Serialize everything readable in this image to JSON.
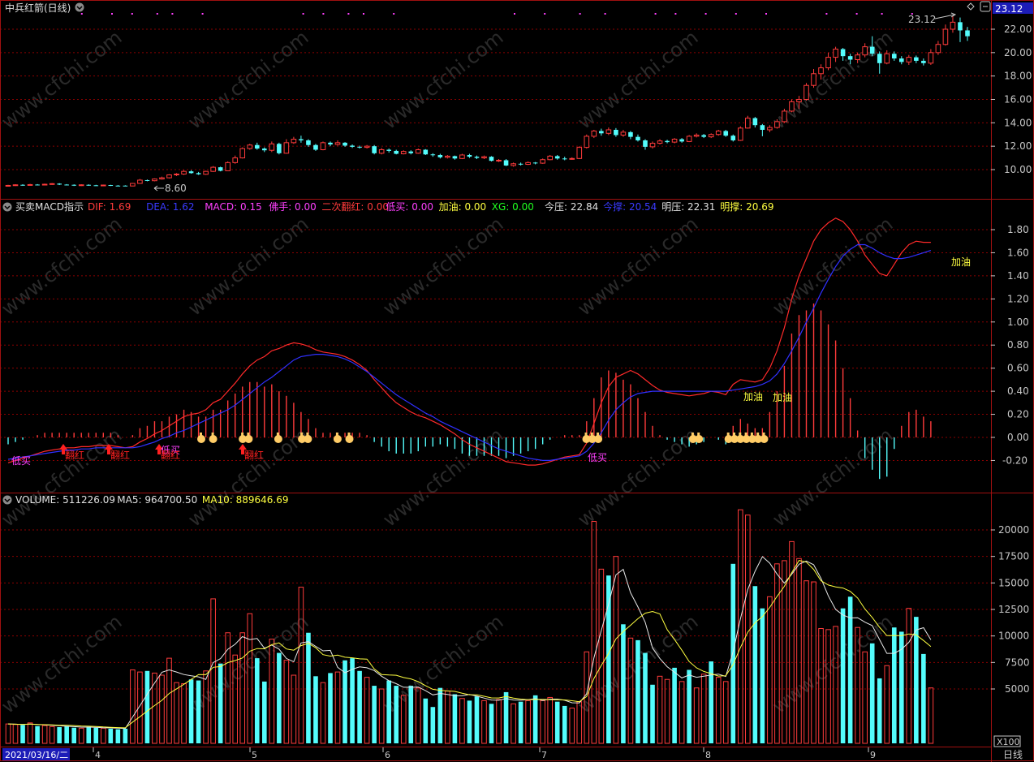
{
  "panels": {
    "price": {
      "title": "中兵红箭(日线)",
      "right_price_tag": "23.12",
      "annot_high": "23.12",
      "annot_low": "8.60",
      "axis_labels": [
        "22.00",
        "20.00",
        "18.00",
        "16.00",
        "14.00",
        "12.00",
        "10.00"
      ]
    },
    "macd": {
      "name": "买卖MACD指示",
      "items": [
        {
          "label": "DIF: 1.69",
          "color": "#ff3b3b"
        },
        {
          "label": "DEA: 1.62",
          "color": "#3a3aff"
        },
        {
          "label": "MACD: 0.15",
          "color": "#ff40ff"
        },
        {
          "label": "佛手: 0.00",
          "color": "#ff40ff"
        },
        {
          "label": "二次翻红: 0.00",
          "color": "#ff3b3b"
        },
        {
          "label": "低买: 0.00",
          "color": "#ff40ff"
        },
        {
          "label": "加油: 0.00",
          "color": "#ffff40"
        },
        {
          "label": "XG: 0.00",
          "color": "#20ff20"
        },
        {
          "label": "今压: 22.84",
          "color": "#e0e0e0"
        },
        {
          "label": "今撑: 20.54",
          "color": "#3a3aff"
        },
        {
          "label": "明压: 22.31",
          "color": "#e0e0e0"
        },
        {
          "label": "明撑: 20.69",
          "color": "#ffff40"
        }
      ],
      "axis_labels": [
        "1.80",
        "1.60",
        "1.40",
        "1.20",
        "1.00",
        "0.80",
        "0.60",
        "0.40",
        "0.20",
        "0.00",
        "-0.20"
      ],
      "signals": {
        "low_buy": "低买",
        "turn_red": "翻红",
        "refuel": "加油",
        "low_buy_turn": "低买 翻红"
      }
    },
    "volume": {
      "items": [
        {
          "label": "VOLUME: 511226.09",
          "color": "#e0e0e0"
        },
        {
          "label": "MA5: 964700.50",
          "color": "#e0e0e0"
        },
        {
          "label": "MA10: 889646.69",
          "color": "#ffff40"
        }
      ],
      "axis_labels": [
        "20000",
        "17500",
        "15000",
        "12500",
        "10000",
        "7500",
        "5000"
      ],
      "unit": "X100"
    }
  },
  "xaxis": {
    "start_date": "2021/03/16/二",
    "months": [
      "4",
      "5",
      "6",
      "7",
      "8",
      "9"
    ],
    "period": "日线"
  },
  "watermark": "www.cfchi.com",
  "colors": {
    "up": "#ff3b3b",
    "down": "#54fcfc",
    "grid": "#8b0000",
    "frame": "#a01010",
    "bg": "#000000"
  },
  "chart_data": {
    "type": "candlestick",
    "title": "中兵红箭(日线)",
    "price_range": [
      8.6,
      23.12
    ],
    "volume_unit": "X100",
    "volume_ylim": [
      0,
      22000
    ],
    "macd_ylim": [
      -0.35,
      1.95
    ],
    "candles": [
      [
        8.62,
        8.65,
        8.55,
        8.7,
        1
      ],
      [
        8.65,
        8.7,
        8.6,
        8.75,
        1
      ],
      [
        8.7,
        8.68,
        8.62,
        8.75,
        0
      ],
      [
        8.68,
        8.72,
        8.64,
        8.78,
        1
      ],
      [
        8.72,
        8.7,
        8.66,
        8.76,
        0
      ],
      [
        8.7,
        8.75,
        8.66,
        8.8,
        1
      ],
      [
        8.75,
        8.8,
        8.7,
        8.85,
        1
      ],
      [
        8.8,
        8.72,
        8.68,
        8.84,
        0
      ],
      [
        8.72,
        8.7,
        8.66,
        8.76,
        0
      ],
      [
        8.7,
        8.65,
        8.6,
        8.74,
        0
      ],
      [
        8.65,
        8.7,
        8.6,
        8.74,
        1
      ],
      [
        8.7,
        8.66,
        8.62,
        8.74,
        0
      ],
      [
        8.66,
        8.64,
        8.6,
        8.7,
        0
      ],
      [
        8.64,
        8.68,
        8.6,
        8.72,
        1
      ],
      [
        8.68,
        8.62,
        8.6,
        8.7,
        0
      ],
      [
        8.62,
        8.63,
        8.58,
        8.68,
        0
      ],
      [
        8.63,
        8.6,
        8.6,
        8.66,
        0
      ],
      [
        8.6,
        8.82,
        8.6,
        8.86,
        1
      ],
      [
        8.82,
        9.1,
        8.8,
        9.2,
        1
      ],
      [
        9.1,
        9.05,
        9.0,
        9.15,
        0
      ],
      [
        9.05,
        9.2,
        9.0,
        9.25,
        1
      ],
      [
        9.2,
        9.3,
        9.15,
        9.4,
        1
      ],
      [
        9.3,
        9.55,
        9.25,
        9.6,
        1
      ],
      [
        9.55,
        9.62,
        9.45,
        9.7,
        1
      ],
      [
        9.62,
        9.85,
        9.55,
        9.95,
        1
      ],
      [
        9.85,
        9.7,
        9.65,
        9.95,
        0
      ],
      [
        9.7,
        9.6,
        9.55,
        9.8,
        0
      ],
      [
        9.6,
        9.85,
        9.55,
        9.9,
        1
      ],
      [
        9.85,
        10.2,
        9.8,
        10.3,
        1
      ],
      [
        10.2,
        9.9,
        9.85,
        10.25,
        0
      ],
      [
        9.9,
        10.6,
        9.88,
        10.7,
        1
      ],
      [
        10.6,
        11.0,
        10.5,
        11.2,
        1
      ],
      [
        11.0,
        11.8,
        10.95,
        11.9,
        1
      ],
      [
        11.8,
        12.1,
        11.7,
        12.2,
        1
      ],
      [
        12.1,
        11.8,
        11.7,
        12.3,
        0
      ],
      [
        11.8,
        11.65,
        11.5,
        11.9,
        0
      ],
      [
        11.65,
        12.2,
        11.5,
        12.4,
        1
      ],
      [
        12.2,
        11.4,
        11.3,
        12.3,
        0
      ],
      [
        11.4,
        12.3,
        11.35,
        12.6,
        1
      ],
      [
        12.3,
        12.6,
        12.2,
        12.8,
        1
      ],
      [
        12.6,
        12.5,
        12.3,
        12.9,
        0
      ],
      [
        12.5,
        12.1,
        11.95,
        12.6,
        0
      ],
      [
        12.1,
        11.7,
        11.6,
        12.2,
        0
      ],
      [
        11.7,
        12.3,
        11.65,
        12.4,
        1
      ],
      [
        12.3,
        12.15,
        12.0,
        12.4,
        0
      ],
      [
        12.15,
        12.3,
        12.05,
        12.5,
        1
      ],
      [
        12.3,
        12.05,
        11.95,
        12.35,
        0
      ],
      [
        12.05,
        11.95,
        11.85,
        12.15,
        0
      ],
      [
        11.95,
        11.9,
        11.8,
        12.05,
        0
      ],
      [
        11.9,
        12.0,
        11.8,
        12.1,
        1
      ],
      [
        12.0,
        11.4,
        11.3,
        12.1,
        0
      ],
      [
        11.4,
        11.7,
        11.3,
        11.85,
        1
      ],
      [
        11.7,
        11.6,
        11.45,
        11.8,
        0
      ],
      [
        11.6,
        11.35,
        11.3,
        11.7,
        0
      ],
      [
        11.35,
        11.55,
        11.3,
        11.65,
        1
      ],
      [
        11.55,
        11.4,
        11.3,
        11.65,
        0
      ],
      [
        11.4,
        11.7,
        11.35,
        11.8,
        1
      ],
      [
        11.7,
        11.3,
        11.25,
        11.75,
        0
      ],
      [
        11.3,
        11.25,
        11.1,
        11.4,
        0
      ],
      [
        11.25,
        11.05,
        10.95,
        11.35,
        0
      ],
      [
        11.05,
        11.15,
        10.95,
        11.25,
        1
      ],
      [
        11.15,
        10.95,
        10.85,
        11.2,
        0
      ],
      [
        10.95,
        11.25,
        10.9,
        11.35,
        1
      ],
      [
        11.25,
        11.1,
        11.0,
        11.35,
        0
      ],
      [
        11.1,
        11.0,
        10.9,
        11.2,
        0
      ],
      [
        11.0,
        11.1,
        10.9,
        11.2,
        1
      ],
      [
        11.1,
        10.75,
        10.7,
        11.15,
        0
      ],
      [
        10.75,
        10.8,
        10.65,
        10.9,
        1
      ],
      [
        10.8,
        10.35,
        10.3,
        10.9,
        0
      ],
      [
        10.35,
        10.5,
        10.25,
        10.6,
        1
      ],
      [
        10.5,
        10.45,
        10.35,
        10.6,
        0
      ],
      [
        10.45,
        10.6,
        10.4,
        10.7,
        1
      ],
      [
        10.6,
        10.55,
        10.45,
        10.65,
        0
      ],
      [
        10.55,
        10.85,
        10.5,
        10.95,
        1
      ],
      [
        10.85,
        11.15,
        10.8,
        11.25,
        1
      ],
      [
        11.15,
        10.95,
        10.85,
        11.25,
        0
      ],
      [
        10.95,
        10.9,
        10.8,
        11.1,
        0
      ],
      [
        10.9,
        10.95,
        10.85,
        11.05,
        1
      ],
      [
        10.95,
        11.9,
        10.9,
        12.0,
        1
      ],
      [
        11.9,
        12.85,
        11.8,
        13.0,
        1
      ],
      [
        12.85,
        13.3,
        12.7,
        13.4,
        1
      ],
      [
        13.3,
        13.1,
        12.9,
        13.5,
        0
      ],
      [
        13.1,
        13.4,
        12.95,
        13.6,
        1
      ],
      [
        13.4,
        12.95,
        12.8,
        13.55,
        0
      ],
      [
        12.95,
        13.2,
        12.8,
        13.4,
        1
      ],
      [
        13.2,
        12.8,
        12.6,
        13.3,
        0
      ],
      [
        12.8,
        12.5,
        12.4,
        13.0,
        0
      ],
      [
        12.5,
        11.95,
        11.7,
        12.6,
        0
      ],
      [
        11.95,
        12.25,
        11.8,
        12.4,
        1
      ],
      [
        12.25,
        12.45,
        12.15,
        12.6,
        1
      ],
      [
        12.45,
        12.35,
        12.25,
        12.55,
        0
      ],
      [
        12.35,
        12.6,
        12.25,
        12.7,
        1
      ],
      [
        12.6,
        12.4,
        12.3,
        12.7,
        0
      ],
      [
        12.4,
        12.85,
        12.35,
        12.95,
        1
      ],
      [
        12.85,
        12.95,
        12.75,
        13.1,
        1
      ],
      [
        12.95,
        12.8,
        12.7,
        13.05,
        0
      ],
      [
        12.8,
        13.0,
        12.7,
        13.1,
        1
      ],
      [
        13.0,
        13.3,
        12.9,
        13.4,
        1
      ],
      [
        13.3,
        12.9,
        12.8,
        13.4,
        0
      ],
      [
        12.9,
        12.5,
        12.4,
        13.0,
        0
      ],
      [
        12.5,
        13.55,
        12.45,
        13.7,
        1
      ],
      [
        13.55,
        14.4,
        13.5,
        14.6,
        1
      ],
      [
        14.4,
        13.8,
        13.6,
        14.5,
        0
      ],
      [
        13.8,
        13.4,
        12.85,
        13.9,
        0
      ],
      [
        13.4,
        13.6,
        13.2,
        13.8,
        1
      ],
      [
        13.6,
        14.1,
        13.5,
        14.3,
        1
      ],
      [
        14.1,
        15.0,
        14.0,
        15.2,
        1
      ],
      [
        15.0,
        15.8,
        14.9,
        16.0,
        1
      ],
      [
        15.8,
        16.0,
        15.2,
        16.3,
        1
      ],
      [
        16.0,
        17.2,
        15.9,
        17.4,
        1
      ],
      [
        17.2,
        18.2,
        17.0,
        18.6,
        1
      ],
      [
        18.2,
        18.7,
        17.7,
        19.0,
        1
      ],
      [
        18.7,
        19.6,
        18.5,
        20.0,
        1
      ],
      [
        19.6,
        20.3,
        19.2,
        20.5,
        1
      ],
      [
        20.3,
        19.7,
        19.3,
        20.4,
        0
      ],
      [
        19.7,
        19.4,
        19.0,
        19.9,
        0
      ],
      [
        19.4,
        19.8,
        19.1,
        20.0,
        1
      ],
      [
        19.8,
        20.5,
        19.6,
        20.8,
        1
      ],
      [
        20.5,
        19.9,
        19.7,
        21.4,
        0
      ],
      [
        19.9,
        19.1,
        18.2,
        20.1,
        0
      ],
      [
        19.1,
        19.9,
        19.0,
        20.2,
        1
      ],
      [
        19.9,
        19.5,
        19.3,
        20.1,
        0
      ],
      [
        19.5,
        19.2,
        19.0,
        19.7,
        0
      ],
      [
        19.2,
        19.6,
        18.95,
        19.8,
        1
      ],
      [
        19.6,
        19.3,
        19.1,
        19.75,
        0
      ],
      [
        19.3,
        19.1,
        18.9,
        19.5,
        0
      ],
      [
        19.1,
        20.0,
        18.95,
        20.3,
        1
      ],
      [
        20.0,
        20.7,
        19.8,
        21.0,
        1
      ],
      [
        20.7,
        22.0,
        20.6,
        22.4,
        1
      ],
      [
        22.0,
        22.6,
        21.7,
        23.12,
        1
      ],
      [
        22.6,
        21.9,
        20.9,
        23.0,
        0
      ],
      [
        21.9,
        21.4,
        21.0,
        22.2,
        0
      ]
    ],
    "volumes": [
      1700,
      1650,
      1600,
      1800,
      1500,
      1550,
      1450,
      1400,
      1500,
      1350,
      1300,
      1450,
      1350,
      1300,
      1250,
      1200,
      1250,
      6800,
      6600,
      6700,
      6500,
      6300,
      7900,
      5600,
      5500,
      5900,
      5800,
      6700,
      13500,
      7400,
      10300,
      8200,
      10300,
      12100,
      7900,
      5700,
      9700,
      8400,
      7700,
      6300,
      14600,
      10300,
      6200,
      5600,
      6500,
      6600,
      7700,
      7900,
      6700,
      6100,
      5300,
      5000,
      5800,
      5300,
      4400,
      5300,
      5100,
      4100,
      3300,
      5100,
      4800,
      4500,
      4100,
      3900,
      4300,
      3900,
      3600,
      4000,
      4700,
      3600,
      3800,
      3900,
      4400,
      3900,
      4200,
      3800,
      3400,
      3200,
      3800,
      8500,
      20800,
      16300,
      15700,
      17500,
      11100,
      9800,
      9600,
      8400,
      5400,
      6200,
      5900,
      7000,
      5700,
      6800,
      5100,
      6400,
      7600,
      6100,
      5700,
      16800,
      21900,
      21400,
      14700,
      12600,
      13700,
      16800,
      17100,
      18900,
      17300,
      15200,
      15100,
      10700,
      10600,
      10900,
      12600,
      13700,
      10800,
      8500,
      9300,
      6000,
      7200,
      10800,
      10400,
      12600,
      11800,
      8300,
      5100
    ],
    "down_flags": [
      0,
      0,
      1,
      0,
      1,
      0,
      0,
      1,
      1,
      1,
      0,
      1,
      1,
      0,
      1,
      1,
      1,
      0,
      0,
      1,
      0,
      0,
      0,
      0,
      0,
      1,
      1,
      0,
      0,
      1,
      0,
      0,
      0,
      0,
      1,
      1,
      0,
      1,
      0,
      0,
      0,
      1,
      1,
      0,
      1,
      0,
      1,
      1,
      1,
      0,
      1,
      0,
      1,
      1,
      0,
      1,
      0,
      1,
      1,
      1,
      0,
      1,
      0,
      1,
      1,
      0,
      1,
      0,
      1,
      0,
      1,
      0,
      1,
      0,
      0,
      1,
      1,
      0,
      0,
      0,
      0,
      0,
      1,
      0,
      1,
      0,
      1,
      1,
      1,
      0,
      0,
      1,
      0,
      1,
      0,
      0,
      1,
      0,
      0,
      1,
      0,
      0,
      1,
      1,
      0,
      0,
      0,
      0,
      0,
      0,
      0,
      0,
      0,
      0,
      1,
      1,
      0,
      0,
      1,
      1,
      0,
      1,
      1,
      0,
      1,
      1,
      0,
      0,
      0,
      0,
      1,
      1
    ],
    "dif": [
      -0.22,
      -0.2,
      -0.18,
      -0.16,
      -0.14,
      -0.12,
      -0.11,
      -0.1,
      -0.09,
      -0.09,
      -0.08,
      -0.08,
      -0.07,
      -0.07,
      -0.07,
      -0.08,
      -0.09,
      -0.08,
      -0.04,
      -0.01,
      0.03,
      0.06,
      0.1,
      0.14,
      0.18,
      0.2,
      0.21,
      0.24,
      0.3,
      0.33,
      0.4,
      0.47,
      0.55,
      0.62,
      0.67,
      0.7,
      0.75,
      0.77,
      0.8,
      0.82,
      0.81,
      0.79,
      0.76,
      0.74,
      0.73,
      0.72,
      0.7,
      0.67,
      0.63,
      0.58,
      0.5,
      0.43,
      0.36,
      0.3,
      0.26,
      0.22,
      0.19,
      0.17,
      0.14,
      0.11,
      0.07,
      0.03,
      -0.02,
      -0.06,
      -0.09,
      -0.12,
      -0.15,
      -0.18,
      -0.21,
      -0.22,
      -0.23,
      -0.24,
      -0.24,
      -0.23,
      -0.21,
      -0.19,
      -0.17,
      -0.16,
      -0.15,
      -0.05,
      0.12,
      0.3,
      0.44,
      0.52,
      0.55,
      0.58,
      0.55,
      0.5,
      0.45,
      0.41,
      0.39,
      0.38,
      0.37,
      0.36,
      0.37,
      0.38,
      0.4,
      0.39,
      0.37,
      0.46,
      0.5,
      0.49,
      0.48,
      0.5,
      0.6,
      0.75,
      0.95,
      1.2,
      1.4,
      1.55,
      1.7,
      1.8,
      1.86,
      1.9,
      1.87,
      1.8,
      1.7,
      1.58,
      1.5,
      1.42,
      1.4,
      1.5,
      1.6,
      1.67,
      1.7,
      1.69,
      1.69
    ],
    "dea": [
      -0.19,
      -0.18,
      -0.17,
      -0.16,
      -0.15,
      -0.14,
      -0.13,
      -0.12,
      -0.11,
      -0.11,
      -0.1,
      -0.1,
      -0.09,
      -0.09,
      -0.09,
      -0.09,
      -0.09,
      -0.09,
      -0.08,
      -0.06,
      -0.04,
      -0.01,
      0.01,
      0.04,
      0.06,
      0.09,
      0.12,
      0.15,
      0.18,
      0.21,
      0.24,
      0.28,
      0.33,
      0.38,
      0.43,
      0.48,
      0.52,
      0.57,
      0.62,
      0.67,
      0.7,
      0.71,
      0.72,
      0.72,
      0.71,
      0.7,
      0.68,
      0.65,
      0.61,
      0.57,
      0.52,
      0.47,
      0.42,
      0.37,
      0.33,
      0.29,
      0.25,
      0.21,
      0.18,
      0.14,
      0.11,
      0.08,
      0.05,
      0.02,
      -0.01,
      -0.04,
      -0.07,
      -0.1,
      -0.12,
      -0.14,
      -0.16,
      -0.18,
      -0.19,
      -0.2,
      -0.2,
      -0.19,
      -0.18,
      -0.17,
      -0.16,
      -0.12,
      -0.05,
      0.04,
      0.15,
      0.24,
      0.3,
      0.35,
      0.38,
      0.39,
      0.4,
      0.4,
      0.4,
      0.4,
      0.4,
      0.4,
      0.4,
      0.4,
      0.4,
      0.4,
      0.4,
      0.41,
      0.42,
      0.43,
      0.44,
      0.46,
      0.49,
      0.55,
      0.64,
      0.75,
      0.87,
      1.0,
      1.12,
      1.25,
      1.37,
      1.48,
      1.57,
      1.63,
      1.67,
      1.67,
      1.64,
      1.6,
      1.57,
      1.55,
      1.55,
      1.56,
      1.58,
      1.6,
      1.62
    ]
  }
}
